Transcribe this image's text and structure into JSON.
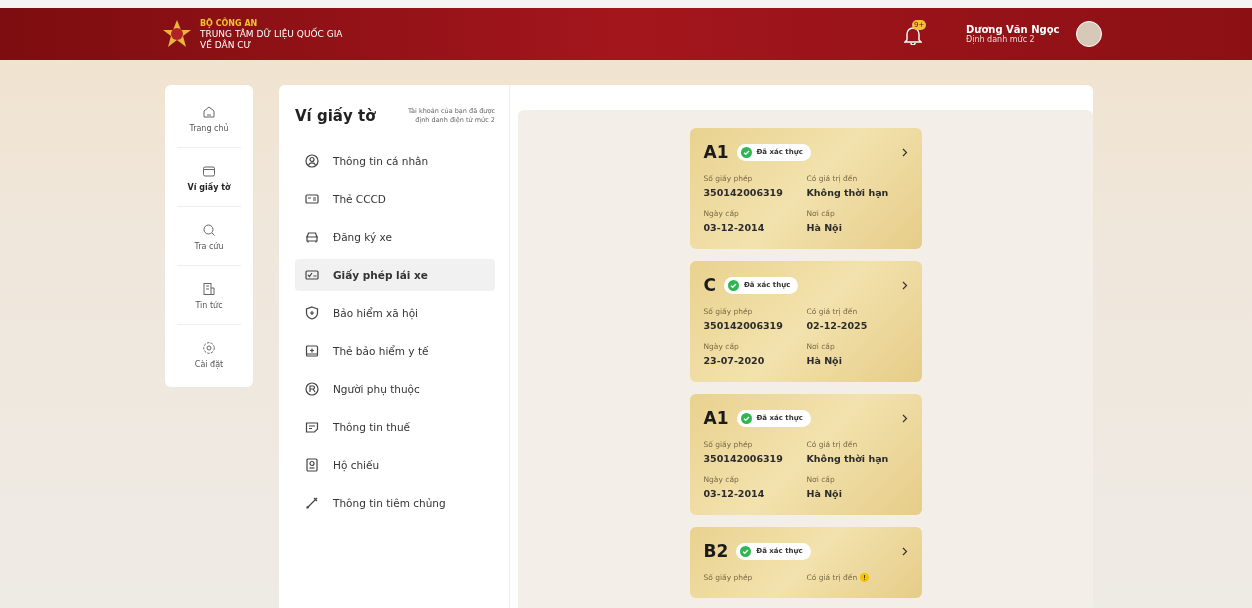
{
  "header": {
    "agency": "BỘ CÔNG AN",
    "center_line1": "TRUNG TÂM DỮ LIỆU QUỐC GIA",
    "center_line2": "VỀ DÂN CƯ",
    "notification_badge": "9+",
    "user_name": "Dương Văn Ngọc",
    "user_level": "Định danh mức 2"
  },
  "nav": [
    {
      "kind": "home",
      "label": "Trang chủ",
      "selected": false
    },
    {
      "kind": "wallet",
      "label": "Ví giấy tờ",
      "selected": true
    },
    {
      "kind": "search",
      "label": "Tra cứu",
      "selected": false
    },
    {
      "kind": "news",
      "label": "Tin tức",
      "selected": false
    },
    {
      "kind": "settings",
      "label": "Cài đặt",
      "selected": false
    }
  ],
  "wallet": {
    "title": "Ví giấy tờ",
    "note": "Tài khoản của bạn đã được định danh điện tử mức 2",
    "items": [
      {
        "kind": "person",
        "label": "Thông tin cá nhân",
        "selected": false
      },
      {
        "kind": "idcard",
        "label": "Thẻ CCCD",
        "selected": false
      },
      {
        "kind": "car",
        "label": "Đăng ký xe",
        "selected": false
      },
      {
        "kind": "license",
        "label": "Giấy phép lái xe",
        "selected": true
      },
      {
        "kind": "shield",
        "label": "Bảo hiểm xã hội",
        "selected": false
      },
      {
        "kind": "health",
        "label": "Thẻ bảo hiểm y tế",
        "selected": false
      },
      {
        "kind": "dependent",
        "label": "Người phụ thuộc",
        "selected": false
      },
      {
        "kind": "tax",
        "label": "Thông tin thuế",
        "selected": false
      },
      {
        "kind": "passport",
        "label": "Hộ chiếu",
        "selected": false
      },
      {
        "kind": "vaccine",
        "label": "Thông tin tiêm chủng",
        "selected": false
      }
    ]
  },
  "licenses": [
    {
      "class": "A1",
      "status": "Đã xác thực",
      "number_label": "Số giấy phép",
      "number": "350142006319",
      "expiry_label": "Có giá trị đến",
      "expiry": "Không thời hạn",
      "expiry_warning": false,
      "issued_label": "Ngày cấp",
      "issued": "03-12-2014",
      "place_label": "Nơi cấp",
      "place": "Hà Nội"
    },
    {
      "class": "C",
      "status": "Đã xác thực",
      "number_label": "Số giấy phép",
      "number": "350142006319",
      "expiry_label": "Có giá trị đến",
      "expiry": "02-12-2025",
      "expiry_warning": false,
      "issued_label": "Ngày cấp",
      "issued": "23-07-2020",
      "place_label": "Nơi cấp",
      "place": "Hà Nội"
    },
    {
      "class": "A1",
      "status": "Đã xác thực",
      "number_label": "Số giấy phép",
      "number": "350142006319",
      "expiry_label": "Có giá trị đến",
      "expiry": "Không thời hạn",
      "expiry_warning": false,
      "issued_label": "Ngày cấp",
      "issued": "03-12-2014",
      "place_label": "Nơi cấp",
      "place": "Hà Nội"
    },
    {
      "class": "B2",
      "status": "Đã xác thực",
      "number_label": "Số giấy phép",
      "expiry_label": "Có giá trị đến",
      "expiry_warning": true
    }
  ]
}
